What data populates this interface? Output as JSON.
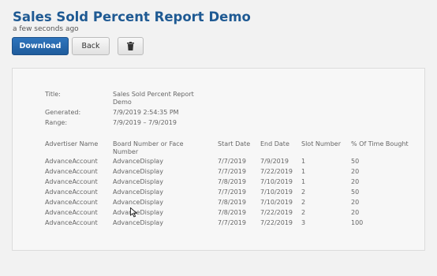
{
  "header": {
    "title": "Sales Sold Percent Report Demo",
    "subtitle": "a few seconds ago"
  },
  "toolbar": {
    "download_label": "Download",
    "back_label": "Back",
    "delete_icon": "trash-icon"
  },
  "report": {
    "title_label": "Title:",
    "title_value_line1": "Sales Sold Percent Report",
    "title_value_line2": "Demo",
    "generated_label": "Generated:",
    "generated_value": "7/9/2019 2:54:35 PM",
    "range_label": "Range:",
    "range_value": "7/9/2019 – 7/9/2019",
    "columns": {
      "advertiser": "Advertiser Name",
      "board_line1": "Board Number or Face",
      "board_line2": "Number",
      "start": "Start Date",
      "end": "End Date",
      "slot": "Slot Number",
      "pct": "% Of Time Bought"
    },
    "rows": [
      {
        "advertiser": "AdvanceAccount",
        "board": "AdvanceDisplay",
        "start": "7/7/2019",
        "end": "7/9/2019",
        "slot": "1",
        "pct": "50"
      },
      {
        "advertiser": "AdvanceAccount",
        "board": "AdvanceDisplay",
        "start": "7/7/2019",
        "end": "7/22/2019",
        "slot": "1",
        "pct": "20"
      },
      {
        "advertiser": "AdvanceAccount",
        "board": "AdvanceDisplay",
        "start": "7/8/2019",
        "end": "7/10/2019",
        "slot": "1",
        "pct": "20"
      },
      {
        "advertiser": "AdvanceAccount",
        "board": "AdvanceDisplay",
        "start": "7/7/2019",
        "end": "7/10/2019",
        "slot": "2",
        "pct": "50"
      },
      {
        "advertiser": "AdvanceAccount",
        "board": "AdvanceDisplay",
        "start": "7/8/2019",
        "end": "7/10/2019",
        "slot": "2",
        "pct": "20"
      },
      {
        "advertiser": "AdvanceAccount",
        "board": "AdvanceDisplay",
        "start": "7/8/2019",
        "end": "7/22/2019",
        "slot": "2",
        "pct": "20"
      },
      {
        "advertiser": "AdvanceAccount",
        "board": "AdvanceDisplay",
        "start": "7/7/2019",
        "end": "7/22/2019",
        "slot": "3",
        "pct": "100"
      }
    ]
  }
}
